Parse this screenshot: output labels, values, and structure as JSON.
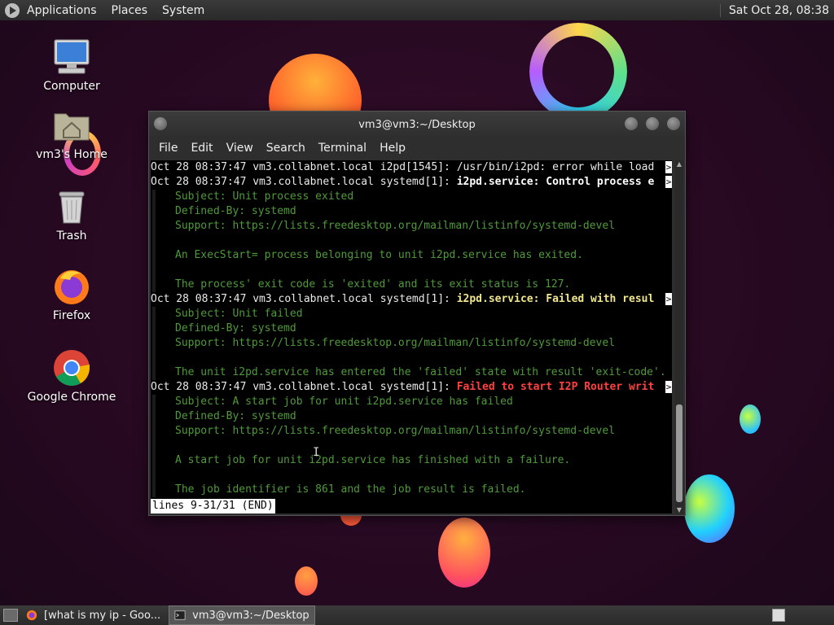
{
  "top_panel": {
    "menus": [
      "Applications",
      "Places",
      "System"
    ],
    "clock": "Sat Oct 28, 08:38"
  },
  "desktop_icons": [
    {
      "label": "Computer",
      "icon": "computer-icon"
    },
    {
      "label": "vm3's Home",
      "icon": "home-folder-icon"
    },
    {
      "label": "Trash",
      "icon": "trash-icon"
    },
    {
      "label": "Firefox",
      "icon": "firefox-icon"
    },
    {
      "label": "Google Chrome",
      "icon": "chrome-icon"
    }
  ],
  "terminal": {
    "title": "vm3@vm3:~/Desktop",
    "menus": [
      "File",
      "Edit",
      "View",
      "Search",
      "Terminal",
      "Help"
    ],
    "lines": [
      {
        "prefix": "Oct 28 08:37:47 vm3.collabnet.local i2pd[1545]: ",
        "highlight": "/usr/bin/i2pd: error while load",
        "style": "plain"
      },
      {
        "prefix": "Oct 28 08:37:47 vm3.collabnet.local systemd[1]: ",
        "highlight": "i2pd.service: Control process e",
        "style": "white"
      },
      {
        "text": "Subject: Unit process exited"
      },
      {
        "text": "Defined-By: systemd"
      },
      {
        "text": "Support: https://lists.freedesktop.org/mailman/listinfo/systemd-devel"
      },
      {
        "text": ""
      },
      {
        "text": "An ExecStart= process belonging to unit i2pd.service has exited."
      },
      {
        "text": ""
      },
      {
        "text": "The process' exit code is 'exited' and its exit status is 127."
      },
      {
        "prefix": "Oct 28 08:37:47 vm3.collabnet.local systemd[1]: ",
        "highlight": "i2pd.service: Failed with resul",
        "style": "yellow"
      },
      {
        "text": "Subject: Unit failed"
      },
      {
        "text": "Defined-By: systemd"
      },
      {
        "text": "Support: https://lists.freedesktop.org/mailman/listinfo/systemd-devel"
      },
      {
        "text": ""
      },
      {
        "text": "The unit i2pd.service has entered the 'failed' state with result 'exit-code'."
      },
      {
        "prefix": "Oct 28 08:37:47 vm3.collabnet.local systemd[1]: ",
        "highlight": "Failed to start I2P Router writ",
        "style": "red"
      },
      {
        "text": "Subject: A start job for unit i2pd.service has failed"
      },
      {
        "text": "Defined-By: systemd"
      },
      {
        "text": "Support: https://lists.freedesktop.org/mailman/listinfo/systemd-devel"
      },
      {
        "text": ""
      },
      {
        "text": "A start job for unit i2pd.service has finished with a failure."
      },
      {
        "text": ""
      },
      {
        "text": "The job identifier is 861 and the job result is failed."
      }
    ],
    "status": "lines 9-31/31 (END)"
  },
  "taskbar": {
    "tasks": [
      {
        "label": "[what is my ip - Goo...",
        "icon": "firefox-icon",
        "active": false
      },
      {
        "label": "vm3@vm3:~/Desktop",
        "icon": "terminal-icon",
        "active": true
      }
    ]
  },
  "colors": {
    "log_green": "#4f9a3a",
    "bold_yellow": "#f0e68c",
    "bold_red": "#ff4040"
  }
}
